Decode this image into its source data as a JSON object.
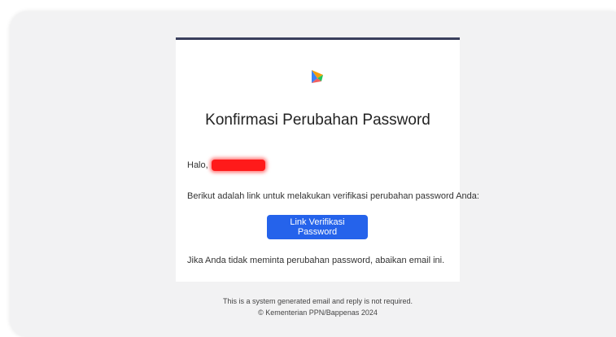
{
  "email": {
    "title": "Konfirmasi Perubahan Password",
    "greeting": "Halo,",
    "intro_text": "Berikut adalah link untuk melakukan verifikasi perubahan password Anda:",
    "button_label": "Link Verifikasi Password",
    "ignore_text": "Jika Anda tidak meminta perubahan password, abaikan email ini.",
    "logo_icon": "bappenas-logo-icon"
  },
  "footer": {
    "line1": "This is a system generated email and reply is not required.",
    "line2": "© Kementerian PPN/Bappenas 2024"
  },
  "colors": {
    "accent": "#2563eb",
    "top_border": "#3a3f5c",
    "redaction": "#ff1a1a"
  }
}
